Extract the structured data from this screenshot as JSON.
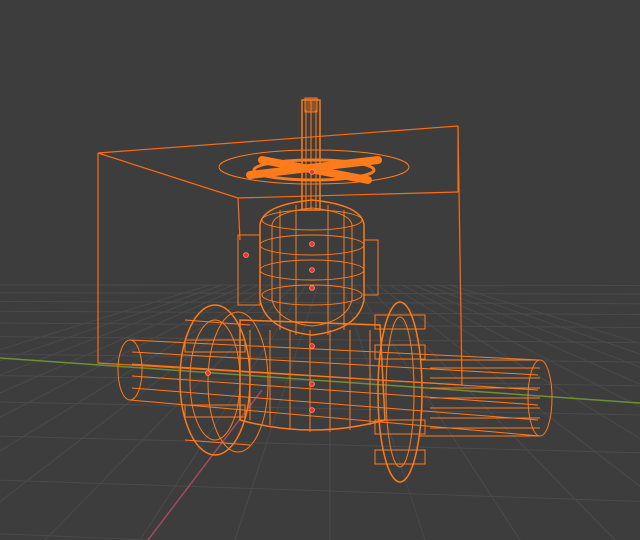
{
  "viewport": {
    "background_color": "#3d3d3d",
    "grid_color": "#4a4a4a",
    "x_axis_color": "#7a9a3a",
    "y_axis_color": "#9a4a5a"
  },
  "object": {
    "name_semantic": "gate-valve-wireframe",
    "selected": true,
    "wire_color": "#ff7a1a",
    "bbox_color": "#ff6a10",
    "origin_color": "#ff3030"
  }
}
